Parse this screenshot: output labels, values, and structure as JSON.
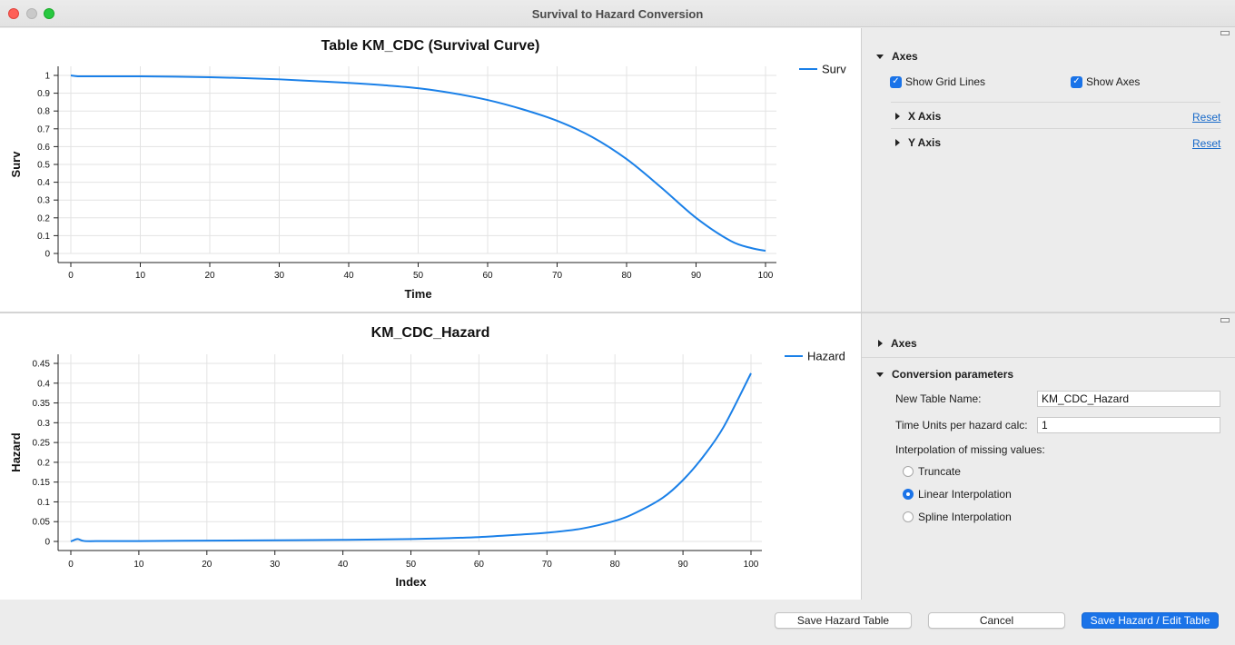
{
  "window": {
    "title": "Survival to Hazard Conversion"
  },
  "top_panel": {
    "axes_label": "Axes",
    "show_grid_lines": {
      "label": "Show Grid Lines",
      "checked": true
    },
    "show_axes": {
      "label": "Show Axes",
      "checked": true
    },
    "x_axis": {
      "label": "X Axis",
      "reset": "Reset"
    },
    "y_axis": {
      "label": "Y Axis",
      "reset": "Reset"
    }
  },
  "bottom_panel": {
    "axes_label": "Axes",
    "conversion_label": "Conversion parameters",
    "new_table_name": {
      "label": "New Table Name:",
      "value": "KM_CDC_Hazard"
    },
    "time_units": {
      "label": "Time Units per hazard calc:",
      "value": "1"
    },
    "interp_label": "Interpolation of missing values:",
    "options": [
      {
        "label": "Truncate",
        "selected": false
      },
      {
        "label": "Linear Interpolation",
        "selected": true
      },
      {
        "label": "Spline Interpolation",
        "selected": false
      }
    ]
  },
  "buttons": {
    "save_hazard_table": "Save Hazard Table",
    "cancel": "Cancel",
    "save_edit": "Save Hazard / Edit Table"
  },
  "colors": {
    "accent": "#1a73e8",
    "line": "#1a80e8"
  },
  "chart_data": [
    {
      "type": "line",
      "title": "Table KM_CDC (Survival Curve)",
      "xlabel": "Time",
      "ylabel": "Surv",
      "xlim": [
        0,
        100
      ],
      "ylim": [
        0,
        1
      ],
      "xticks": [
        0,
        10,
        20,
        30,
        40,
        50,
        60,
        70,
        80,
        90,
        100
      ],
      "yticks": [
        0,
        0.1,
        0.2,
        0.3,
        0.4,
        0.5,
        0.6,
        0.7,
        0.8,
        0.9,
        1
      ],
      "ytick_labels": [
        "0",
        "0.1",
        "0.2",
        "0.3",
        "0.4",
        "0.5",
        "0.6",
        "0.7",
        "0.8",
        "0.9",
        "1"
      ],
      "grid": true,
      "legend_position": "top-right",
      "series": [
        {
          "name": "Surv",
          "x": [
            0,
            1,
            2,
            5,
            10,
            15,
            20,
            25,
            30,
            35,
            40,
            45,
            50,
            55,
            60,
            65,
            70,
            75,
            80,
            85,
            90,
            95,
            98,
            100
          ],
          "y": [
            1.0,
            0.995,
            0.995,
            0.995,
            0.995,
            0.993,
            0.99,
            0.985,
            0.978,
            0.968,
            0.958,
            0.945,
            0.928,
            0.9,
            0.862,
            0.81,
            0.745,
            0.655,
            0.53,
            0.37,
            0.2,
            0.07,
            0.03,
            0.015
          ]
        }
      ]
    },
    {
      "type": "line",
      "title": "KM_CDC_Hazard",
      "xlabel": "Index",
      "ylabel": "Hazard",
      "xlim": [
        0,
        100
      ],
      "ylim": [
        0,
        0.45
      ],
      "xticks": [
        0,
        10,
        20,
        30,
        40,
        50,
        60,
        70,
        80,
        90,
        100
      ],
      "yticks": [
        0,
        0.05,
        0.1,
        0.15,
        0.2,
        0.25,
        0.3,
        0.35,
        0.4,
        0.45
      ],
      "ytick_labels": [
        "0",
        "0.05",
        "0.1",
        "0.15",
        "0.2",
        "0.25",
        "0.3",
        "0.35",
        "0.4",
        "0.45"
      ],
      "grid": true,
      "legend_position": "top-right",
      "series": [
        {
          "name": "Hazard",
          "x": [
            0,
            1,
            2,
            5,
            10,
            20,
            30,
            40,
            50,
            55,
            60,
            65,
            70,
            75,
            80,
            83,
            87,
            90,
            93,
            96,
            100
          ],
          "y": [
            0.0,
            0.006,
            0.001,
            0.001,
            0.001,
            0.002,
            0.003,
            0.004,
            0.006,
            0.008,
            0.011,
            0.016,
            0.022,
            0.032,
            0.052,
            0.072,
            0.11,
            0.155,
            0.215,
            0.29,
            0.425
          ]
        }
      ]
    }
  ]
}
